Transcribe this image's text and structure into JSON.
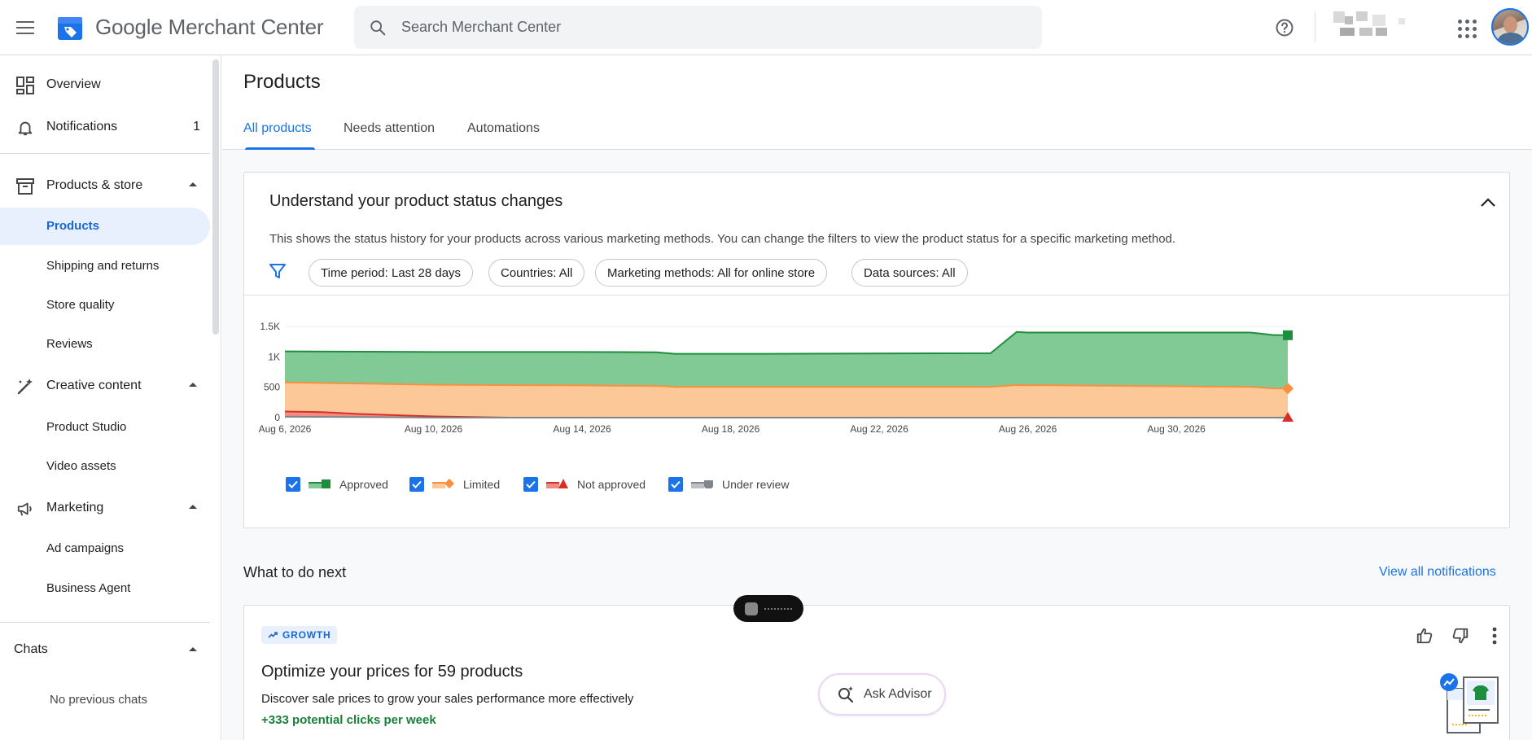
{
  "header": {
    "brand": "Google Merchant Center",
    "search_placeholder": "Search Merchant Center"
  },
  "sidebar": {
    "overview": "Overview",
    "notifications": "Notifications",
    "notifications_count": "1",
    "products_store": "Products & store",
    "products": "Products",
    "shipping_returns": "Shipping and returns",
    "store_quality": "Store quality",
    "reviews": "Reviews",
    "creative_content": "Creative content",
    "product_studio": "Product Studio",
    "video_assets": "Video assets",
    "marketing": "Marketing",
    "ad_campaigns": "Ad campaigns",
    "business_agent": "Business Agent",
    "chats": "Chats",
    "no_chats": "No previous chats"
  },
  "page": {
    "title": "Products",
    "tabs": [
      {
        "label": "All products",
        "active": true
      },
      {
        "label": "Needs attention",
        "active": false
      },
      {
        "label": "Automations",
        "active": false
      }
    ]
  },
  "status_card": {
    "title": "Understand your product status changes",
    "description": "This shows the status history for your products across various marketing methods. You can change the filters to view the product status for a specific marketing method.",
    "chips": [
      "Time period: Last 28 days",
      "Countries: All",
      "Marketing methods: All for online store",
      "Data sources: All"
    ]
  },
  "chart_data": {
    "type": "area",
    "x_ticks": [
      "Aug 6, 2026",
      "Aug 10, 2026",
      "Aug 14, 2026",
      "Aug 18, 2026",
      "Aug 22, 2026",
      "Aug 26, 2026",
      "Aug 30, 2026"
    ],
    "y_ticks": [
      "0",
      "500",
      "1K",
      "1.5K"
    ],
    "ylim": [
      0,
      1500
    ],
    "x_range": [
      "2026-08-06",
      "2026-09-02"
    ],
    "series": [
      {
        "name": "Approved",
        "color": "#1e8e3e",
        "fill": "#81c995",
        "points": [
          [
            "2026-08-06",
            1090
          ],
          [
            "2026-08-08",
            1085
          ],
          [
            "2026-08-10",
            1080
          ],
          [
            "2026-08-14",
            1080
          ],
          [
            "2026-08-16",
            1075
          ],
          [
            "2026-08-16.5",
            1050
          ],
          [
            "2026-08-19",
            1050
          ],
          [
            "2026-08-25",
            1060
          ],
          [
            "2026-08-25.7",
            1410
          ],
          [
            "2026-08-26",
            1400
          ],
          [
            "2026-09-01",
            1400
          ],
          [
            "2026-09-01.6",
            1360
          ],
          [
            "2026-09-02",
            1355
          ]
        ]
      },
      {
        "name": "Limited",
        "color": "#fa903e",
        "fill": "#fcc898",
        "points": [
          [
            "2026-08-06",
            580
          ],
          [
            "2026-08-08",
            560
          ],
          [
            "2026-08-10",
            540
          ],
          [
            "2026-08-14",
            530
          ],
          [
            "2026-08-16",
            520
          ],
          [
            "2026-08-16.5",
            505
          ],
          [
            "2026-08-25",
            505
          ],
          [
            "2026-08-25.7",
            535
          ],
          [
            "2026-08-27",
            530
          ],
          [
            "2026-09-01",
            505
          ],
          [
            "2026-09-01.6",
            480
          ],
          [
            "2026-09-02",
            478
          ]
        ]
      },
      {
        "name": "Not approved",
        "color": "#d93025",
        "fill": "#f28b82",
        "points": [
          [
            "2026-08-06",
            100
          ],
          [
            "2026-08-07",
            90
          ],
          [
            "2026-08-08",
            60
          ],
          [
            "2026-08-10",
            20
          ],
          [
            "2026-08-12",
            0
          ],
          [
            "2026-09-02",
            0
          ]
        ]
      },
      {
        "name": "Under review",
        "color": "#80868b",
        "fill": "#bdc1c6",
        "points": [
          [
            "2026-08-06",
            15
          ],
          [
            "2026-08-08",
            10
          ],
          [
            "2026-08-10",
            0
          ],
          [
            "2026-09-02",
            0
          ]
        ]
      }
    ]
  },
  "next": {
    "title": "What to do next",
    "view_all": "View all notifications"
  },
  "growth_card": {
    "badge": "GROWTH",
    "title": "Optimize your prices for 59 products",
    "description": "Discover sale prices to grow your sales performance more effectively",
    "metric": "+333 potential clicks per week"
  },
  "advisor": {
    "label": "Ask Advisor"
  }
}
